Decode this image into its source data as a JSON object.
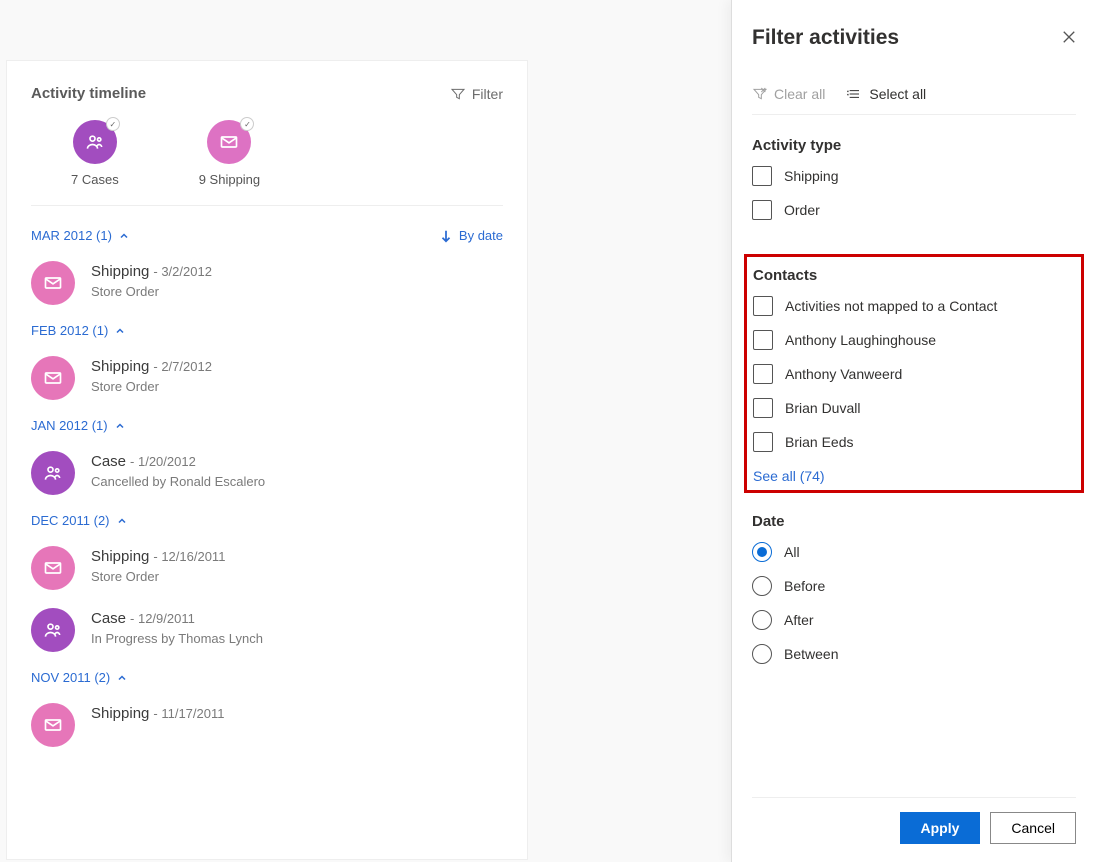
{
  "timeline": {
    "title": "Activity timeline",
    "filter_label": "Filter",
    "summary": [
      {
        "count_label": "7 Cases",
        "color": "purple",
        "icon": "person"
      },
      {
        "count_label": "9 Shipping",
        "color": "pink",
        "icon": "mail"
      }
    ],
    "sort_label": "By date",
    "groups": [
      {
        "header": "MAR 2012 (1)",
        "items": [
          {
            "type": "Shipping",
            "date": "3/2/2012",
            "sub": "Store Order",
            "icon": "mail",
            "color": "pink"
          }
        ]
      },
      {
        "header": "FEB 2012 (1)",
        "items": [
          {
            "type": "Shipping",
            "date": "2/7/2012",
            "sub": "Store Order",
            "icon": "mail",
            "color": "pink"
          }
        ]
      },
      {
        "header": "JAN 2012 (1)",
        "items": [
          {
            "type": "Case",
            "date": "1/20/2012",
            "sub": "Cancelled by Ronald Escalero",
            "icon": "person",
            "color": "purple"
          }
        ]
      },
      {
        "header": "DEC 2011 (2)",
        "items": [
          {
            "type": "Shipping",
            "date": "12/16/2011",
            "sub": "Store Order",
            "icon": "mail",
            "color": "pink"
          },
          {
            "type": "Case",
            "date": "12/9/2011",
            "sub": "In Progress by Thomas Lynch",
            "icon": "person",
            "color": "purple"
          }
        ]
      },
      {
        "header": "NOV 2011 (2)",
        "items": [
          {
            "type": "Shipping",
            "date": "11/17/2011",
            "sub": "",
            "icon": "mail",
            "color": "pink"
          }
        ]
      }
    ]
  },
  "panel": {
    "title": "Filter activities",
    "clear_label": "Clear all",
    "select_label": "Select all",
    "activity_type_title": "Activity type",
    "activity_types": [
      "Shipping",
      "Order"
    ],
    "contacts_title": "Contacts",
    "contacts": [
      "Activities not mapped to a Contact",
      "Anthony Laughinghouse",
      "Anthony Vanweerd",
      "Brian Duvall",
      "Brian Eeds"
    ],
    "see_all_label": "See all (74)",
    "date_title": "Date",
    "date_options": [
      "All",
      "Before",
      "After",
      "Between"
    ],
    "date_selected": "All",
    "apply_label": "Apply",
    "cancel_label": "Cancel"
  }
}
